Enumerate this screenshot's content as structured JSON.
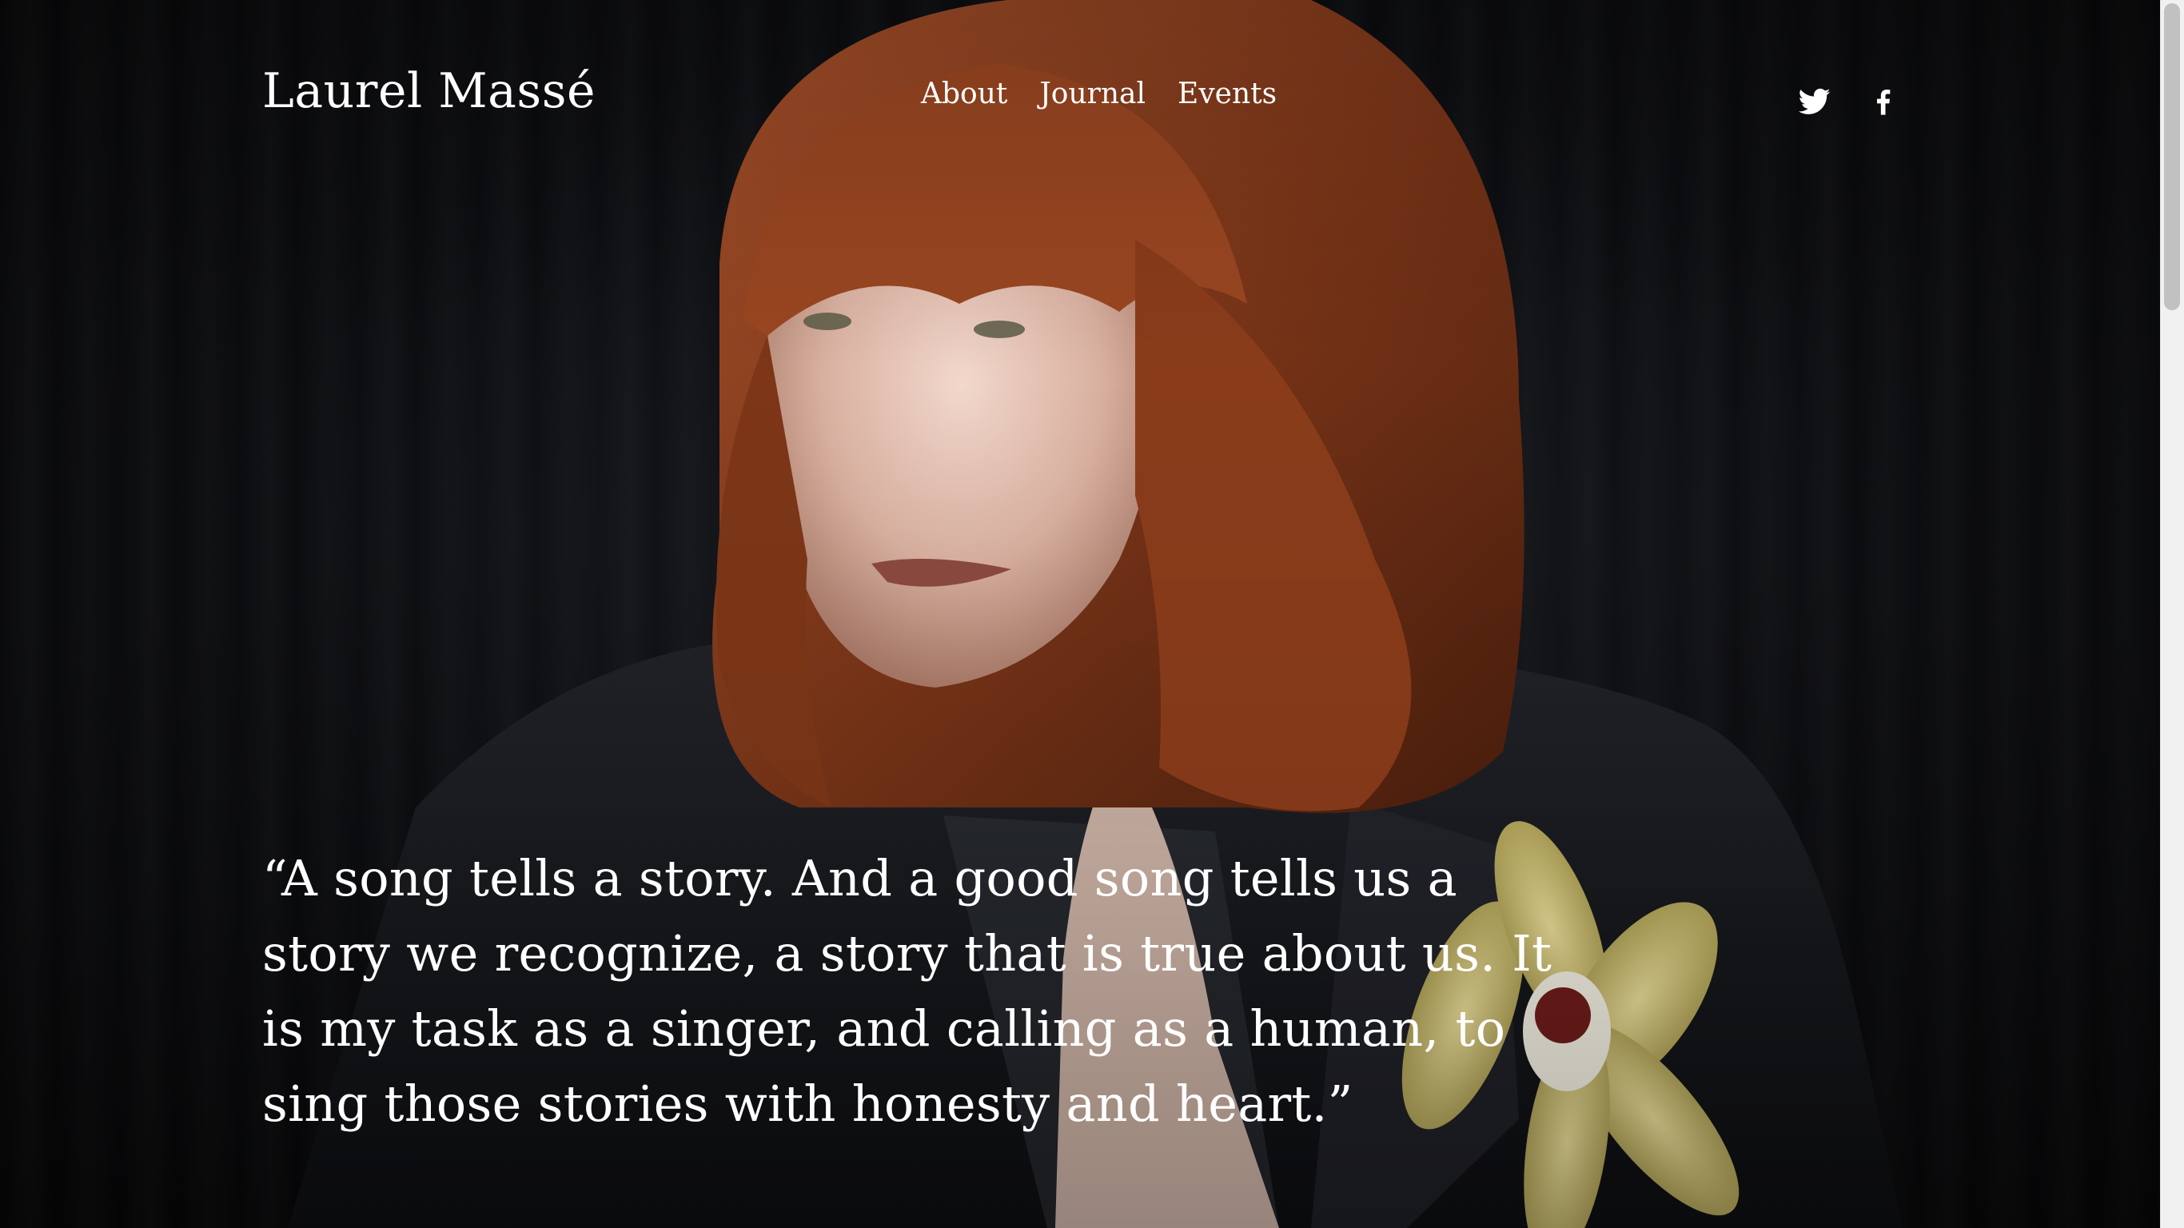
{
  "site": {
    "title": "Laurel Massé"
  },
  "nav": {
    "items": [
      {
        "label": "About"
      },
      {
        "label": "Journal"
      },
      {
        "label": "Events"
      }
    ]
  },
  "social": {
    "items": [
      {
        "icon": "twitter-icon"
      },
      {
        "icon": "facebook-icon"
      }
    ]
  },
  "hero": {
    "quote_lines": [
      "“A song tells a story. And a good song tells us a",
      "story we recognize, a story that is true about us. It",
      "is my task as a singer, and calling as a human, to",
      "sing those stories with honesty and heart.”"
    ]
  },
  "colors": {
    "text": "#ffffff",
    "background": "#0a0a0c",
    "hair": "#8a3f1e",
    "flower": "#d8c77a"
  }
}
